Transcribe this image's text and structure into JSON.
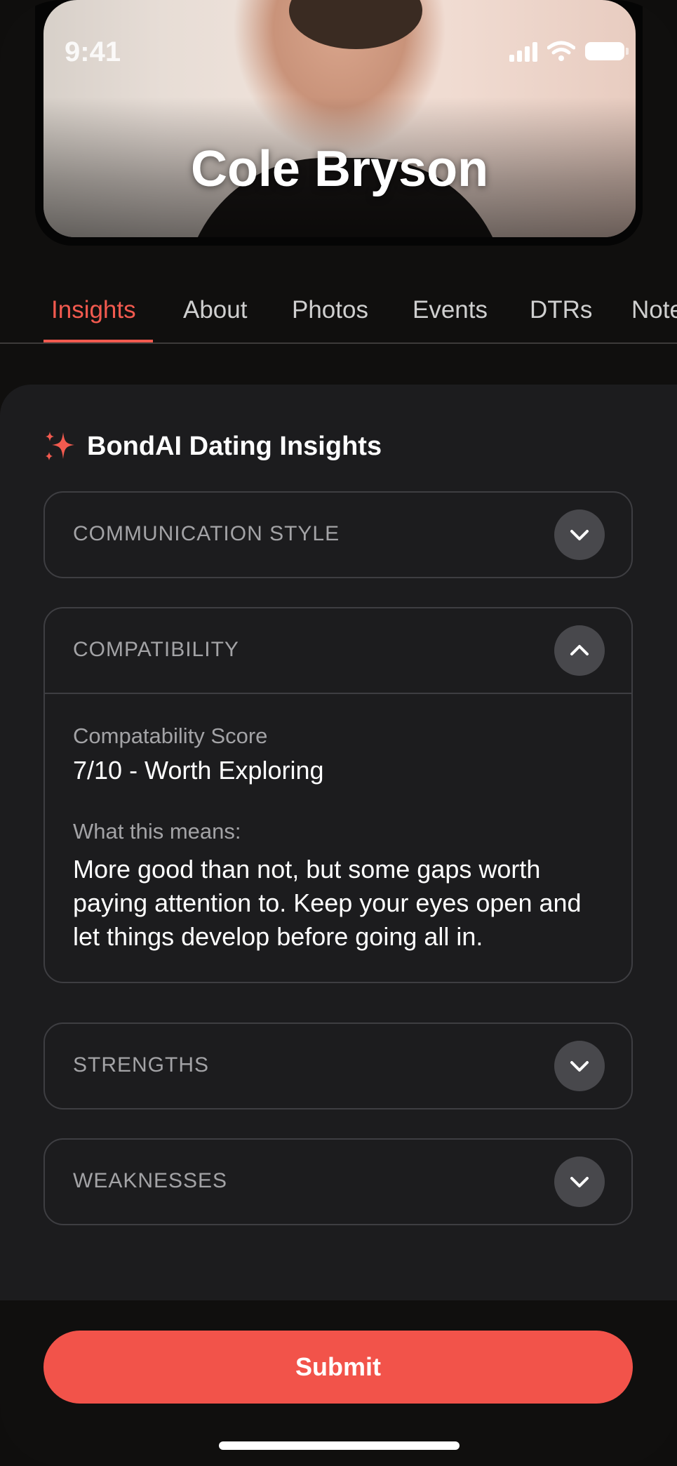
{
  "status_bar": {
    "time": "9:41"
  },
  "profile": {
    "name": "Cole Bryson"
  },
  "tabs": [
    {
      "label": "Insights",
      "active": true
    },
    {
      "label": "About",
      "active": false
    },
    {
      "label": "Photos",
      "active": false
    },
    {
      "label": "Events",
      "active": false
    },
    {
      "label": "DTRs",
      "active": false
    },
    {
      "label": "Notes",
      "active": false
    }
  ],
  "insights": {
    "title": "BondAI Dating Insights",
    "sections": {
      "communication": {
        "title": "COMMUNICATION STYLE",
        "expanded": false
      },
      "compatibility": {
        "title": "COMPATIBILITY",
        "expanded": true,
        "score_label": "Compatability Score",
        "score_value": "7/10 - Worth Exploring",
        "meaning_label": "What this means:",
        "meaning_text": "More good than not, but some gaps worth paying attention to. Keep your eyes open and let things develop before going all in."
      },
      "strengths": {
        "title": "STRENGTHS",
        "expanded": false
      },
      "weaknesses": {
        "title": "WEAKNESSES",
        "expanded": false
      }
    }
  },
  "actions": {
    "submit_label": "Submit"
  },
  "colors": {
    "accent": "#f25a4f",
    "submit": "#f2534a",
    "panel": "#1c1c1e",
    "background": "#100f0e"
  },
  "icons": {
    "sparkle": "sparkle-icon",
    "chevron_down": "chevron-down-icon",
    "chevron_up": "chevron-up-icon",
    "signal": "cellular-signal-icon",
    "wifi": "wifi-icon",
    "battery": "battery-icon"
  }
}
